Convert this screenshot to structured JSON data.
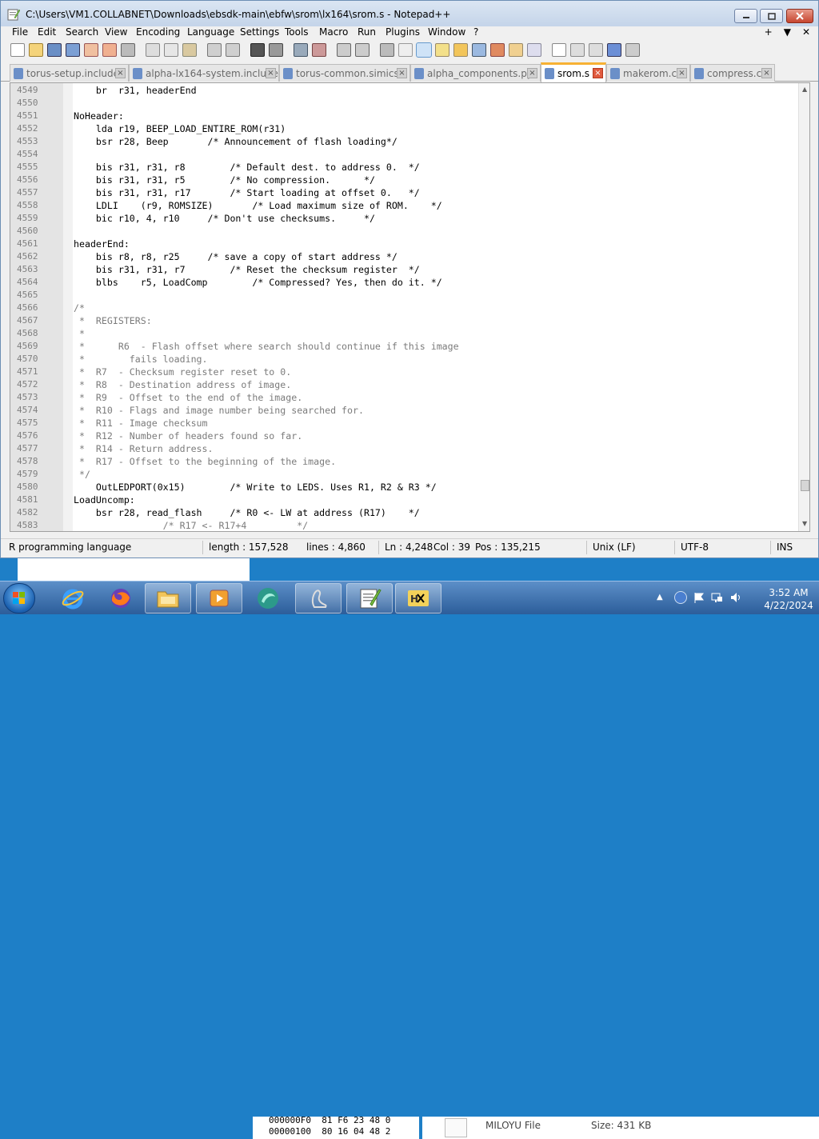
{
  "window": {
    "title": "C:\\Users\\VM1.COLLABNET\\Downloads\\ebsdk-main\\ebfw\\srom\\lx164\\srom.s - Notepad++",
    "min_icon": "minimize-icon",
    "max_icon": "maximize-icon",
    "close_icon": "close-icon"
  },
  "menu": {
    "items": [
      "File",
      "Edit",
      "Search",
      "View",
      "Encoding",
      "Language",
      "Settings",
      "Tools",
      "Macro",
      "Run",
      "Plugins",
      "Window",
      "?"
    ],
    "right": [
      "+",
      "▼",
      "✕"
    ]
  },
  "tabs": [
    {
      "label": "torus-setup.include",
      "active": false
    },
    {
      "label": "alpha-lx164-system.include",
      "active": false
    },
    {
      "label": "torus-common.simics",
      "active": false
    },
    {
      "label": "alpha_components.py",
      "active": false
    },
    {
      "label": "srom.s",
      "active": true
    },
    {
      "label": "makerom.c",
      "active": false
    },
    {
      "label": "compress.c",
      "active": false
    }
  ],
  "editor": {
    "lines": [
      {
        "n": "4549",
        "t": "    br  r31, headerEnd"
      },
      {
        "n": "4550",
        "t": ""
      },
      {
        "n": "4551",
        "t": "NoHeader:"
      },
      {
        "n": "4552",
        "t": "    lda r19, BEEP_LOAD_ENTIRE_ROM(r31)"
      },
      {
        "n": "4553",
        "t": "    bsr r28, Beep       /* Announcement of flash loading*/"
      },
      {
        "n": "4554",
        "t": ""
      },
      {
        "n": "4555",
        "t": "    bis r31, r31, r8        /* Default dest. to address 0.  */"
      },
      {
        "n": "4556",
        "t": "    bis r31, r31, r5        /* No compression.      */"
      },
      {
        "n": "4557",
        "t": "    bis r31, r31, r17       /* Start loading at offset 0.   */"
      },
      {
        "n": "4558",
        "t": "    LDLI    (r9, ROMSIZE)       /* Load maximum size of ROM.    */"
      },
      {
        "n": "4559",
        "t": "    bic r10, 4, r10     /* Don't use checksums.     */"
      },
      {
        "n": "4560",
        "t": ""
      },
      {
        "n": "4561",
        "t": "headerEnd:"
      },
      {
        "n": "4562",
        "t": "    bis r8, r8, r25     /* save a copy of start address */"
      },
      {
        "n": "4563",
        "t": "    bis r31, r31, r7        /* Reset the checksum register  */"
      },
      {
        "n": "4564",
        "t": "    blbs    r5, LoadComp        /* Compressed? Yes, then do it. */"
      },
      {
        "n": "4565",
        "t": ""
      },
      {
        "n": "4566",
        "t": "/*"
      },
      {
        "n": "4567",
        "t": " *  REGISTERS:"
      },
      {
        "n": "4568",
        "t": " *"
      },
      {
        "n": "4569",
        "t": " *      R6  - Flash offset where search should continue if this image"
      },
      {
        "n": "4570",
        "t": " *        fails loading."
      },
      {
        "n": "4571",
        "t": " *  R7  - Checksum register reset to 0."
      },
      {
        "n": "4572",
        "t": " *  R8  - Destination address of image."
      },
      {
        "n": "4573",
        "t": " *  R9  - Offset to the end of the image."
      },
      {
        "n": "4574",
        "t": " *  R10 - Flags and image number being searched for."
      },
      {
        "n": "4575",
        "t": " *  R11 - Image checksum"
      },
      {
        "n": "4576",
        "t": " *  R12 - Number of headers found so far."
      },
      {
        "n": "4577",
        "t": " *  R14 - Return address."
      },
      {
        "n": "4578",
        "t": " *  R17 - Offset to the beginning of the image."
      },
      {
        "n": "4579",
        "t": " */"
      },
      {
        "n": "4580",
        "t": "    OutLEDPORT(0x15)        /* Write to LEDS. Uses R1, R2 & R3 */"
      },
      {
        "n": "4581",
        "t": "LoadUncomp:"
      },
      {
        "n": "4582",
        "t": "    bsr r28, read_flash     /* R0 <- LW at address (R17)    */"
      },
      {
        "n": "4583",
        "t": "                /* R17 <- R17+4         */"
      }
    ]
  },
  "status": {
    "language": "R programming language",
    "length": "length : 157,528",
    "lines": "lines : 4,860",
    "ln": "Ln : 4,248",
    "col": "Col : 39",
    "pos": "Pos : 135,215",
    "eol": "Unix (LF)",
    "encoding": "UTF-8",
    "mode": "INS"
  },
  "background": {
    "hex_line1": "000000F0  81 F6 23 48 0",
    "hex_line2": "00000100  80 16 04 48 2",
    "file_name": "MILOYU File",
    "file_size": "Size: 431 KB"
  },
  "taskbar": {
    "time": "3:52 AM",
    "date": "4/22/2024"
  }
}
